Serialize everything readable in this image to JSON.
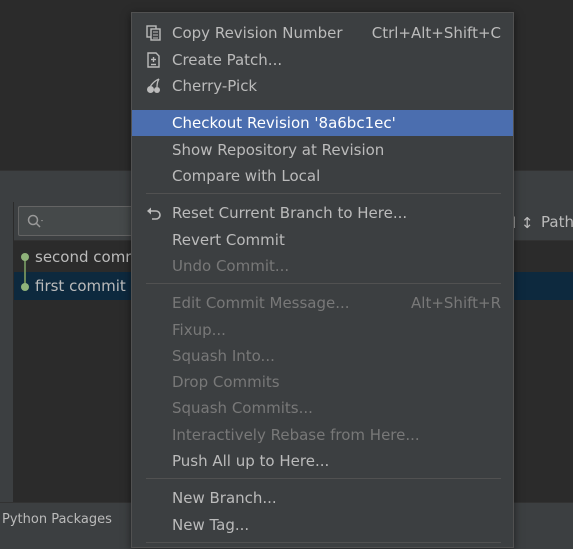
{
  "commit_log": {
    "rows": [
      {
        "message": "second comm"
      },
      {
        "message": "first commit"
      }
    ],
    "column_path": "Path",
    "column_sort_glyph": "l ↕"
  },
  "bottom_bar": {
    "label": "Python Packages"
  },
  "menu": {
    "copy_revision": {
      "label": "Copy Revision Number",
      "shortcut": "Ctrl+Alt+Shift+C"
    },
    "create_patch": {
      "label": "Create Patch..."
    },
    "cherry_pick": {
      "label": "Cherry-Pick"
    },
    "checkout_revision": {
      "label": "Checkout Revision '8a6bc1ec'"
    },
    "show_repository": {
      "label": "Show Repository at Revision"
    },
    "compare_local": {
      "label": "Compare with Local"
    },
    "reset_branch": {
      "label": "Reset Current Branch to Here..."
    },
    "revert_commit": {
      "label": "Revert Commit"
    },
    "undo_commit": {
      "label": "Undo Commit..."
    },
    "edit_message": {
      "label": "Edit Commit Message...",
      "shortcut": "Alt+Shift+R"
    },
    "fixup": {
      "label": "Fixup..."
    },
    "squash_into": {
      "label": "Squash Into..."
    },
    "drop_commits": {
      "label": "Drop Commits"
    },
    "squash_commits": {
      "label": "Squash Commits..."
    },
    "interactive_rebase": {
      "label": "Interactively Rebase from Here..."
    },
    "push_all": {
      "label": "Push All up to Here..."
    },
    "new_branch": {
      "label": "New Branch..."
    },
    "new_tag": {
      "label": "New Tag..."
    }
  },
  "colors": {
    "menu_bg": "#3c3f41",
    "highlight": "#4b6eaf",
    "selected_row": "#0d293e",
    "graph": "#8fb27a",
    "disabled_text": "#787878"
  }
}
